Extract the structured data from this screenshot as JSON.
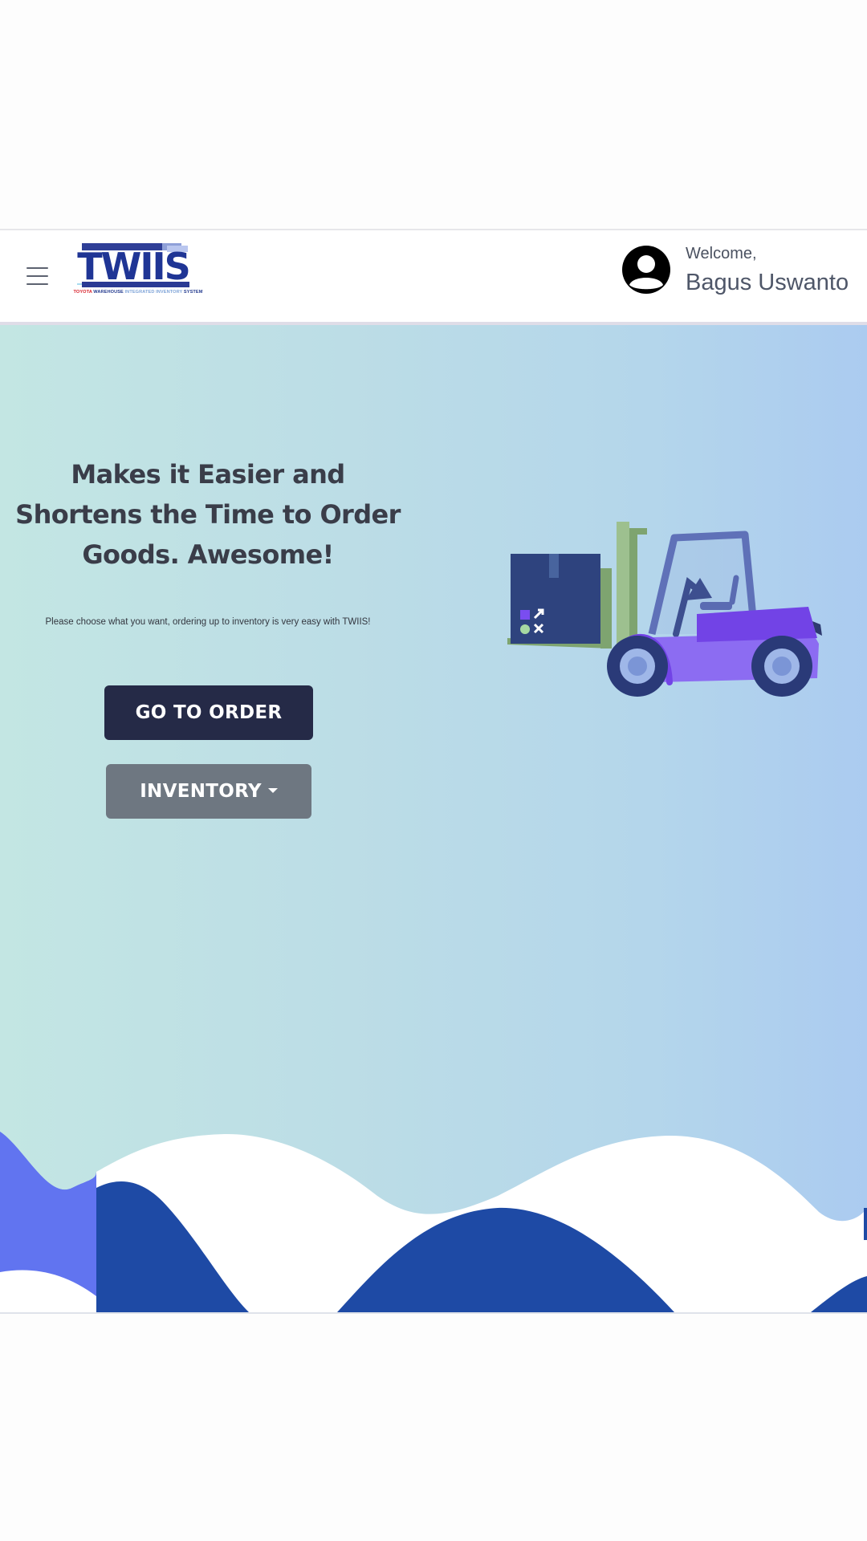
{
  "navbar": {
    "menu_icon": "hamburger-icon",
    "logo": {
      "text": "TWIIS",
      "caption_red": "TOYOTA",
      "caption_blue": "WAREHOUSE",
      "caption_lightblue": "INTEGRATED INVENTORY",
      "caption_dark": "SYSTEM"
    },
    "user": {
      "avatar_icon": "user-circle-icon",
      "welcome": "Welcome,",
      "name": "Bagus Uswanto"
    }
  },
  "hero": {
    "headline": "Makes it Easier and Shortens the Time to Order Goods. Awesome!",
    "subtext": "Please choose what you want, ordering up to inventory is very easy with TWIIS!",
    "primary_button": "GO TO ORDER",
    "secondary_button": "INVENTORY",
    "secondary_button_icon": "caret-down-icon",
    "illustration": "forklift-illustration"
  },
  "colors": {
    "primary_button": "#252a47",
    "secondary_button": "#6e7781",
    "wave_dark": "#1e4aa5",
    "wave_light": "#6274f0",
    "forklift_body": "#8c6cf2"
  }
}
